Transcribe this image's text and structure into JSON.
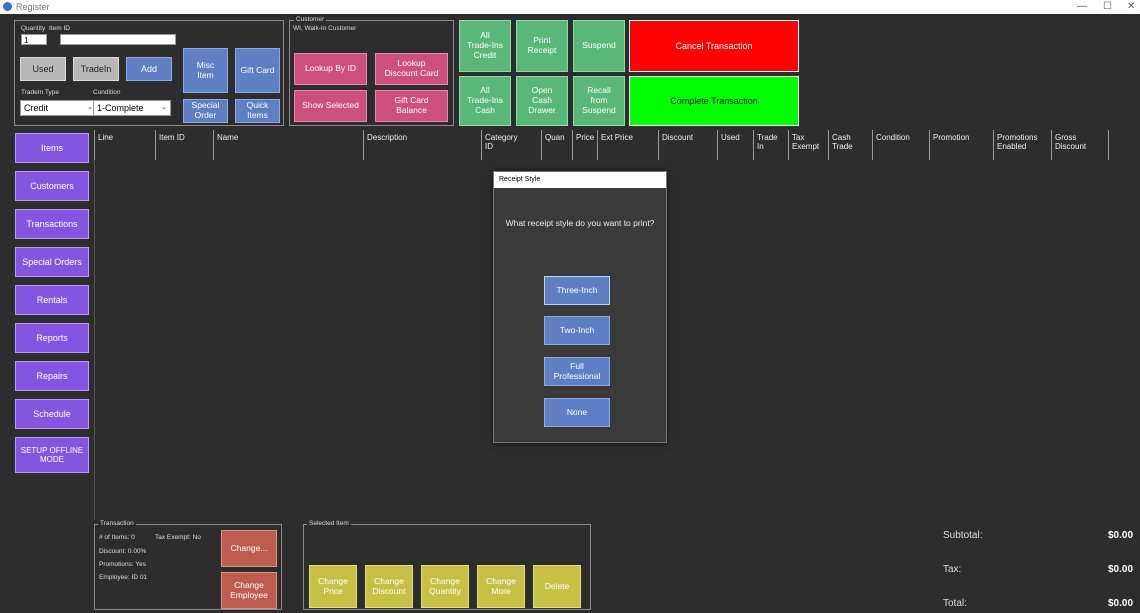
{
  "window": {
    "title": "Register",
    "minimize": "—",
    "maximize": "☐",
    "close": "✕"
  },
  "entry": {
    "quantity_label": "Quantity",
    "item_id_label": "Item ID",
    "quantity_value": "1",
    "item_id_value": "",
    "used_label": "Used",
    "tradein_label": "TradeIn",
    "add_label": "Add",
    "tradein_type_label": "TradeIn Type",
    "tradein_type_value": "Credit",
    "condition_label": "Condition",
    "condition_value": "1-Complete",
    "misc_item": "Misc\nItem",
    "gift_card": "Gift Card",
    "special_order": "Special\nOrder",
    "quick_items": "Quick\nItems"
  },
  "customer": {
    "legend": "Customer",
    "name": "WI, Walk-In Customer",
    "lookup_by_id": "Lookup By ID",
    "lookup_discount": "Lookup\nDiscount Card",
    "show_selected": "Show Selected",
    "gift_card_balance": "Gift Card\nBalance"
  },
  "actions": {
    "all_tradeins_credit": "All\nTrade-Ins\nCredit",
    "print_receipt": "Print\nReceipt",
    "suspend": "Suspend",
    "all_tradeins_cash": "All\nTrade-Ins\nCash",
    "open_cash_drawer": "Open\nCash\nDrawer",
    "recall_from_suspend": "Recall\nfrom\nSuspend",
    "cancel_transaction": "Cancel Transaction",
    "complete_transaction": "Complete Transaction"
  },
  "sidebar": [
    {
      "label": "Items"
    },
    {
      "label": "Customers"
    },
    {
      "label": "Transactions"
    },
    {
      "label": "Special Orders"
    },
    {
      "label": "Rentals"
    },
    {
      "label": "Reports"
    },
    {
      "label": "Repairs"
    },
    {
      "label": "Schedule"
    },
    {
      "label": "SETUP OFFLINE\nMODE"
    }
  ],
  "columns": [
    "Line",
    "Item ID",
    "Name",
    "Description",
    "Category\nID",
    "Quan",
    "Price",
    "Ext Price",
    "Discount",
    "Used",
    "Trade\nIn",
    "Tax\nExempt",
    "Cash\nTrade",
    "Condition",
    "Promotion",
    "Promotions\nEnabled",
    "Gross\nDiscount"
  ],
  "dialog": {
    "title": "Receipt Style",
    "question": "What receipt style do you want to print?",
    "options": [
      "Three-Inch",
      "Two-Inch",
      "Full\nProfessional",
      "None"
    ]
  },
  "transaction": {
    "legend": "Transaction",
    "items_line": "# of Items: 0",
    "tax_exempt_line": "Tax Exempt: No",
    "discount_line": "Discount: 0.00%",
    "promotions_line": "Promotions: Yes",
    "employee_line": "Employee: ID 01",
    "change_btn": "Change...",
    "change_employee_btn": "Change\nEmployee"
  },
  "selected_item": {
    "legend": "Selected Item",
    "change_price": "Change\nPrice",
    "change_discount": "Change\nDiscount",
    "change_quantity": "Change\nQuantity",
    "change_more": "Change\nMore",
    "delete": "Delete"
  },
  "totals": {
    "subtotal_label": "Subtotal:",
    "subtotal_value": "$0.00",
    "tax_label": "Tax:",
    "tax_value": "$0.00",
    "total_label": "Total:",
    "total_value": "$0.00"
  }
}
